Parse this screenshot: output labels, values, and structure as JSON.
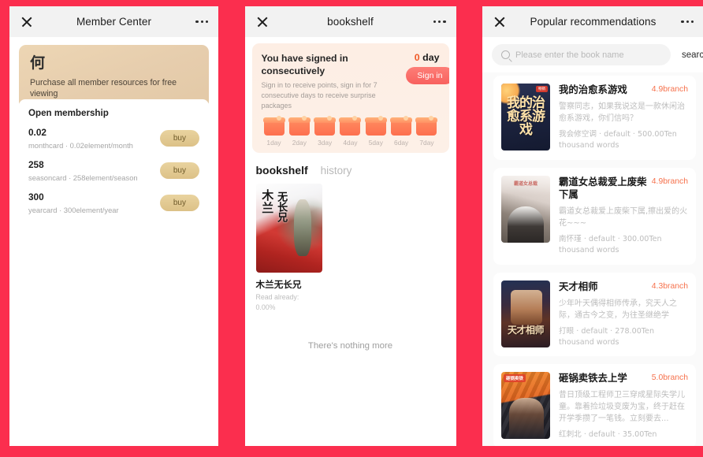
{
  "theme": {
    "page_bg": "#fb2e4e",
    "accent_gold": "#dcc187",
    "accent_orange": "#f6714c"
  },
  "member_center": {
    "nav": {
      "title": "Member Center",
      "close_icon": "close-icon",
      "more_icon": "more-dots-icon"
    },
    "banner": {
      "avatar_char": "何",
      "subtitle": "Purchase all member resources for free viewing"
    },
    "open_membership": {
      "heading": "Open membership",
      "plans": [
        {
          "price": "0.02",
          "desc": "monthcard · 0.02element/month",
          "buy_label": "buy"
        },
        {
          "price": "258",
          "desc": "seasoncard · 258element/season",
          "buy_label": "buy"
        },
        {
          "price": "300",
          "desc": "yearcard · 300element/year",
          "buy_label": "buy"
        }
      ]
    }
  },
  "bookshelf": {
    "nav": {
      "title": "bookshelf",
      "close_icon": "close-icon",
      "more_icon": "more-dots-icon"
    },
    "signin": {
      "title": "You have signed in consecutively",
      "count_number": "0",
      "count_unit": "day",
      "note": "Sign in to receive points, sign in for 7 consecutive days to receive surprise packages",
      "button_label": "Sign in",
      "days": [
        "1day",
        "2day",
        "3day",
        "4day",
        "5day",
        "6day",
        "7day"
      ]
    },
    "tabs": [
      {
        "label": "bookshelf",
        "active": true
      },
      {
        "label": "history",
        "active": false
      }
    ],
    "books": [
      {
        "title": "木兰无长兄",
        "cover_text_right": "木兰",
        "cover_text_left": "无长兄",
        "progress_label": "Read already:",
        "progress_value": "0.00%"
      }
    ],
    "footer_text": "There's nothing more"
  },
  "recommendations": {
    "nav": {
      "title": "Popular recommendations",
      "close_icon": "close-icon",
      "more_icon": "more-dots-icon"
    },
    "search": {
      "placeholder": "Please enter the book name",
      "value": "",
      "button_label": "search",
      "icon": "search-icon"
    },
    "books": [
      {
        "title": "我的治愈系游戏",
        "score": "4.9branch",
        "desc": "警察同志，如果我说这是一款休闲治愈系游戏，你们信吗？",
        "meta": "我会修空调 · default · 500.00Ten thousand words",
        "cover_text": "我的治愈系游戏",
        "cover_tag": "畅销"
      },
      {
        "title": "霸道女总裁爱上废柴下属",
        "score": "4.9branch",
        "desc": "霸道女总裁爱上废柴下属,擦出爱的火花~~~",
        "meta": "南怀瑾 · default · 300.00Ten thousand words",
        "cover_text": "霸道女总裁"
      },
      {
        "title": "天才相师",
        "score": "4.3branch",
        "desc": "少年叶天偶得相师传承，究天人之际，通古今之变，为往圣继绝学",
        "meta": "打眼 · default · 278.00Ten thousand words",
        "cover_text": "天才相师"
      },
      {
        "title": "砸锅卖铁去上学",
        "score": "5.0branch",
        "desc": "昔日顶级工程师卫三穿成星际失学儿童。靠着捡垃圾变废为宝，终于赶在开学季攒了一笔钱。立刻要去...",
        "meta": "红刺北 · default · 35.00Ten",
        "cover_tag": "砸锅卖铁"
      }
    ]
  }
}
